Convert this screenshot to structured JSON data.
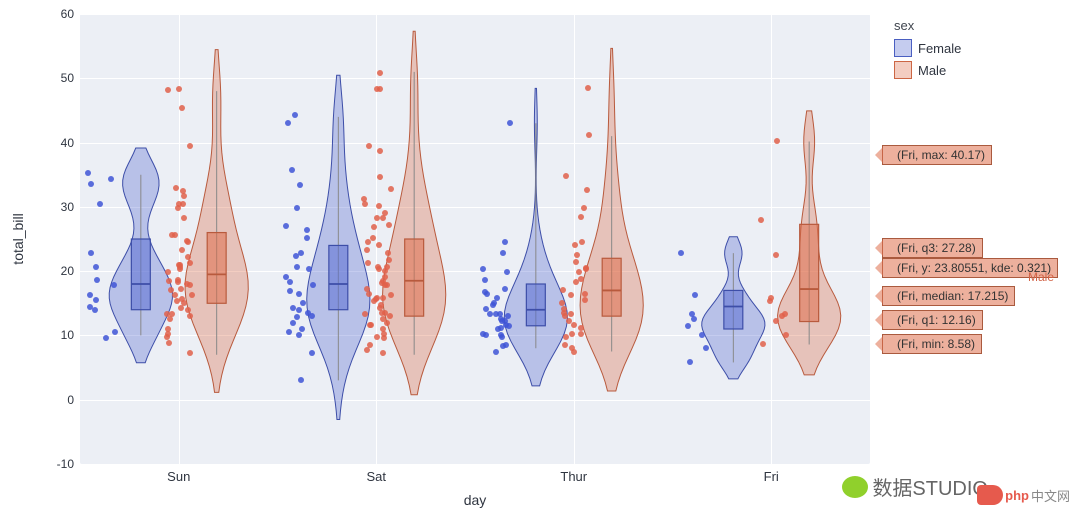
{
  "chart_data": {
    "type": "violin",
    "xlabel": "day",
    "ylabel": "total_bill",
    "xticks": [
      "Sun",
      "Sat",
      "Thur",
      "Fri"
    ],
    "yticks": [
      -10,
      0,
      10,
      20,
      30,
      40,
      50,
      60
    ],
    "ylim": [
      -10,
      60
    ],
    "legend": {
      "title": "sex",
      "entries": [
        "Female",
        "Male"
      ]
    },
    "colors": {
      "Female": "#5a6ed2",
      "Male": "#de704d"
    },
    "series": [
      {
        "day": "Sun",
        "sex": "Female",
        "box": {
          "min": 10,
          "q1": 14,
          "median": 18,
          "q3": 25,
          "max": 35
        },
        "points": [
          9.6,
          10.5,
          14,
          14.5,
          15.5,
          16.3,
          17.9,
          18.7,
          20.6,
          22.8,
          30.4,
          33.5,
          34.3,
          35.3
        ]
      },
      {
        "day": "Sun",
        "sex": "Male",
        "box": {
          "min": 7,
          "q1": 15,
          "median": 19.5,
          "q3": 26,
          "max": 48
        },
        "points": [
          7.3,
          8.8,
          9.7,
          10.3,
          11,
          12.5,
          13,
          13.4,
          13.4,
          14,
          14.3,
          15,
          15.4,
          15.7,
          16.3,
          16.3,
          17,
          17.3,
          17.9,
          18,
          18.3,
          18.4,
          18.7,
          19.8,
          20.3,
          20.7,
          20.9,
          21,
          21.2,
          22.2,
          23.3,
          24.5,
          24.7,
          25.6,
          25.7,
          28.2,
          29.9,
          30.4,
          30.5,
          31.7,
          32.4,
          32.9,
          39.4,
          45.4,
          48.3,
          48.2
        ]
      },
      {
        "day": "Sat",
        "sex": "Female",
        "box": {
          "min": 3,
          "q1": 14,
          "median": 18,
          "q3": 24,
          "max": 44
        },
        "points": [
          3.1,
          7.3,
          10.1,
          10.6,
          11,
          12,
          12.8,
          13,
          13.5,
          14,
          14.3,
          15.1,
          16.4,
          16.9,
          17.8,
          18.3,
          19.1,
          20.3,
          20.7,
          22.4,
          22.8,
          25.2,
          26.4,
          27,
          29.9,
          33.4,
          35.8,
          44.3,
          43.1
        ]
      },
      {
        "day": "Sat",
        "sex": "Male",
        "box": {
          "min": 7,
          "q1": 13,
          "median": 18.5,
          "q3": 25,
          "max": 51
        },
        "points": [
          7.3,
          7.7,
          8.5,
          9.6,
          9.8,
          10.3,
          11,
          11.6,
          11.6,
          12,
          12.5,
          13,
          13.3,
          13.5,
          13.5,
          14.3,
          14.7,
          15.4,
          15.7,
          15.8,
          15.9,
          16.3,
          16.4,
          17.3,
          17.8,
          17.9,
          18.2,
          18.4,
          19.1,
          20.1,
          20.3,
          20.7,
          20.7,
          21.2,
          21.7,
          22.8,
          23.3,
          24.1,
          24.5,
          25.2,
          26.9,
          27.2,
          28.2,
          28.2,
          29.0,
          30.1,
          30.4,
          31.3,
          32.8,
          34.7,
          38.7,
          39.4,
          48.3,
          48.3,
          50.8
        ]
      },
      {
        "day": "Thur",
        "sex": "Female",
        "box": {
          "min": 8,
          "q1": 11.5,
          "median": 14,
          "q3": 18,
          "max": 43
        },
        "points": [
          7.5,
          8.4,
          8.5,
          9.8,
          10,
          10.1,
          10.3,
          11,
          11.2,
          11.4,
          11.7,
          12.2,
          12.3,
          12.5,
          13.1,
          13.3,
          13.4,
          13.4,
          14.1,
          14.8,
          15,
          15.9,
          16.4,
          16.8,
          17.3,
          18.6,
          19.8,
          20.3,
          22.8,
          24.6,
          43.1
        ]
      },
      {
        "day": "Thur",
        "sex": "Male",
        "box": {
          "min": 7.5,
          "q1": 13,
          "median": 17,
          "q3": 22,
          "max": 41
        },
        "points": [
          7.5,
          8,
          8.5,
          9.8,
          10.3,
          10.3,
          11.2,
          11.7,
          12.2,
          13,
          13.4,
          13.5,
          14.1,
          15,
          15.5,
          16.3,
          16.4,
          17,
          18.3,
          18.8,
          19.8,
          20.3,
          20.5,
          21.5,
          22.5,
          24.1,
          24.6,
          28.4,
          29.8,
          32.7,
          34.8,
          41.2,
          48.5
        ]
      },
      {
        "day": "Fri",
        "sex": "Female",
        "box": {
          "min": 5.8,
          "q1": 11,
          "median": 14.5,
          "q3": 17,
          "max": 22.8
        },
        "points": [
          5.8,
          8,
          10.1,
          11.4,
          12.5,
          13.4,
          16.3,
          22.8
        ]
      },
      {
        "day": "Fri",
        "sex": "Male",
        "box": {
          "min": 8.58,
          "q1": 12.16,
          "median": 17.215,
          "q3": 27.28,
          "max": 40.17
        },
        "points": [
          8.6,
          10.1,
          12.2,
          13,
          13.4,
          15.4,
          15.9,
          22.5,
          28,
          40.2
        ]
      }
    ],
    "hover": {
      "series_label": "Male",
      "tags": [
        {
          "text": "(Fri, max: 40.17)",
          "y": 40.17
        },
        {
          "text": "(Fri, q3: 27.28)",
          "y": 27.28
        },
        {
          "text": "(Fri, y: 23.80551, kde: 0.321)",
          "y": 23.8
        },
        {
          "text": "(Fri, median: 17.215)",
          "y": 17.215
        },
        {
          "text": "(Fri, q1: 12.16)",
          "y": 12.16
        },
        {
          "text": "(Fri, min: 8.58)",
          "y": 8.58
        }
      ]
    }
  },
  "watermarks": {
    "studio": "数据STUDIO",
    "php": "php",
    "cn": "中文网"
  }
}
